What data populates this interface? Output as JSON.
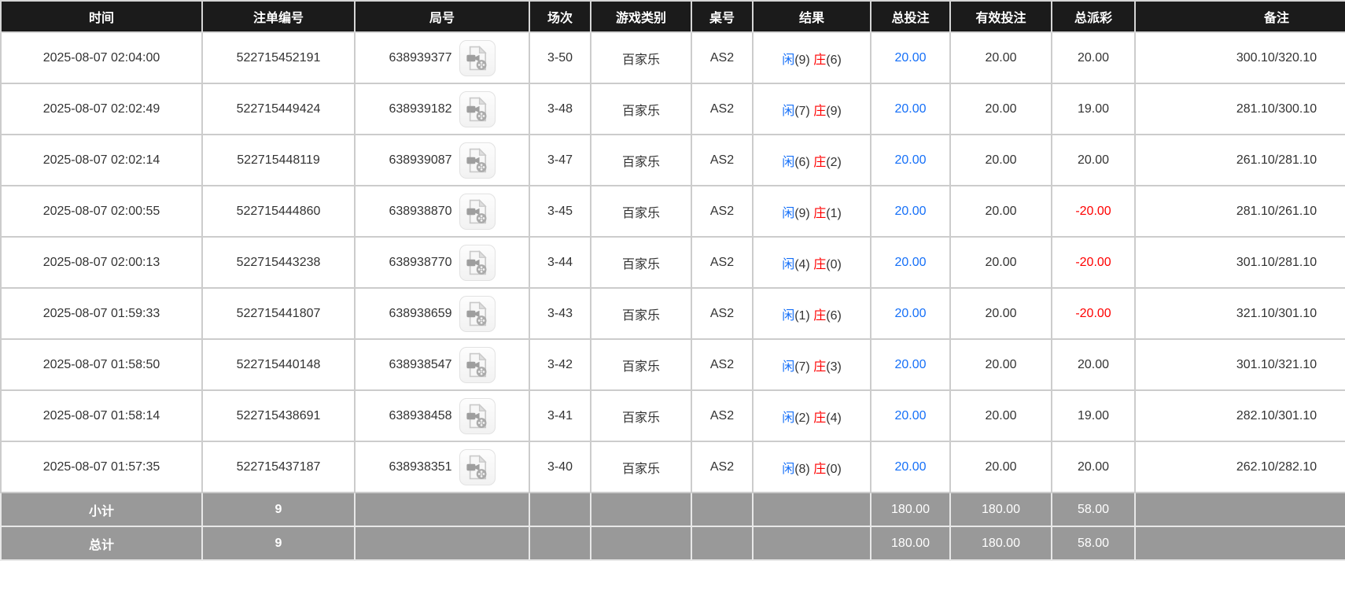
{
  "colors": {
    "header_bg": "#1b1b1b",
    "footer_bg": "#999999",
    "border": "#cccccc",
    "text": "#333333",
    "blue": "#1670f8",
    "red": "#ff0000"
  },
  "table": {
    "columns": [
      {
        "label": "时间"
      },
      {
        "label": "注单编号"
      },
      {
        "label": "局号"
      },
      {
        "label": "场次"
      },
      {
        "label": "游戏类别"
      },
      {
        "label": "桌号"
      },
      {
        "label": "结果"
      },
      {
        "label": "总投注"
      },
      {
        "label": "有效投注"
      },
      {
        "label": "总派彩"
      },
      {
        "label": "备注"
      }
    ],
    "video_icon_name": "video-replay-icon",
    "rows": [
      {
        "time": "2025-08-07 02:04:00",
        "bet_id": "522715452191",
        "round_no": "638939377",
        "session": "3-50",
        "game_type": "百家乐",
        "table_no": "AS2",
        "player": "闲",
        "player_score": "(9)",
        "banker": "庄",
        "banker_score": "(6)",
        "total_bet": "20.00",
        "valid_bet": "20.00",
        "total_payout": "20.00",
        "remark": "300.10/320.10"
      },
      {
        "time": "2025-08-07 02:02:49",
        "bet_id": "522715449424",
        "round_no": "638939182",
        "session": "3-48",
        "game_type": "百家乐",
        "table_no": "AS2",
        "player": "闲",
        "player_score": "(7)",
        "banker": "庄",
        "banker_score": "(9)",
        "total_bet": "20.00",
        "valid_bet": "20.00",
        "total_payout": "19.00",
        "remark": "281.10/300.10"
      },
      {
        "time": "2025-08-07 02:02:14",
        "bet_id": "522715448119",
        "round_no": "638939087",
        "session": "3-47",
        "game_type": "百家乐",
        "table_no": "AS2",
        "player": "闲",
        "player_score": "(6)",
        "banker": "庄",
        "banker_score": "(2)",
        "total_bet": "20.00",
        "valid_bet": "20.00",
        "total_payout": "20.00",
        "remark": "261.10/281.10"
      },
      {
        "time": "2025-08-07 02:00:55",
        "bet_id": "522715444860",
        "round_no": "638938870",
        "session": "3-45",
        "game_type": "百家乐",
        "table_no": "AS2",
        "player": "闲",
        "player_score": "(9)",
        "banker": "庄",
        "banker_score": "(1)",
        "total_bet": "20.00",
        "valid_bet": "20.00",
        "total_payout": "-20.00",
        "remark": "281.10/261.10"
      },
      {
        "time": "2025-08-07 02:00:13",
        "bet_id": "522715443238",
        "round_no": "638938770",
        "session": "3-44",
        "game_type": "百家乐",
        "table_no": "AS2",
        "player": "闲",
        "player_score": "(4)",
        "banker": "庄",
        "banker_score": "(0)",
        "total_bet": "20.00",
        "valid_bet": "20.00",
        "total_payout": "-20.00",
        "remark": "301.10/281.10"
      },
      {
        "time": "2025-08-07 01:59:33",
        "bet_id": "522715441807",
        "round_no": "638938659",
        "session": "3-43",
        "game_type": "百家乐",
        "table_no": "AS2",
        "player": "闲",
        "player_score": "(1)",
        "banker": "庄",
        "banker_score": "(6)",
        "total_bet": "20.00",
        "valid_bet": "20.00",
        "total_payout": "-20.00",
        "remark": "321.10/301.10"
      },
      {
        "time": "2025-08-07 01:58:50",
        "bet_id": "522715440148",
        "round_no": "638938547",
        "session": "3-42",
        "game_type": "百家乐",
        "table_no": "AS2",
        "player": "闲",
        "player_score": "(7)",
        "banker": "庄",
        "banker_score": "(3)",
        "total_bet": "20.00",
        "valid_bet": "20.00",
        "total_payout": "20.00",
        "remark": "301.10/321.10"
      },
      {
        "time": "2025-08-07 01:58:14",
        "bet_id": "522715438691",
        "round_no": "638938458",
        "session": "3-41",
        "game_type": "百家乐",
        "table_no": "AS2",
        "player": "闲",
        "player_score": "(2)",
        "banker": "庄",
        "banker_score": "(4)",
        "total_bet": "20.00",
        "valid_bet": "20.00",
        "total_payout": "19.00",
        "remark": "282.10/301.10"
      },
      {
        "time": "2025-08-07 01:57:35",
        "bet_id": "522715437187",
        "round_no": "638938351",
        "session": "3-40",
        "game_type": "百家乐",
        "table_no": "AS2",
        "player": "闲",
        "player_score": "(8)",
        "banker": "庄",
        "banker_score": "(0)",
        "total_bet": "20.00",
        "valid_bet": "20.00",
        "total_payout": "20.00",
        "remark": "262.10/282.10"
      }
    ],
    "footer_rows": [
      {
        "label": "小计",
        "count": "9",
        "total_bet": "180.00",
        "valid_bet": "180.00",
        "total_payout": "58.00"
      },
      {
        "label": "总计",
        "count": "9",
        "total_bet": "180.00",
        "valid_bet": "180.00",
        "total_payout": "58.00"
      }
    ]
  }
}
